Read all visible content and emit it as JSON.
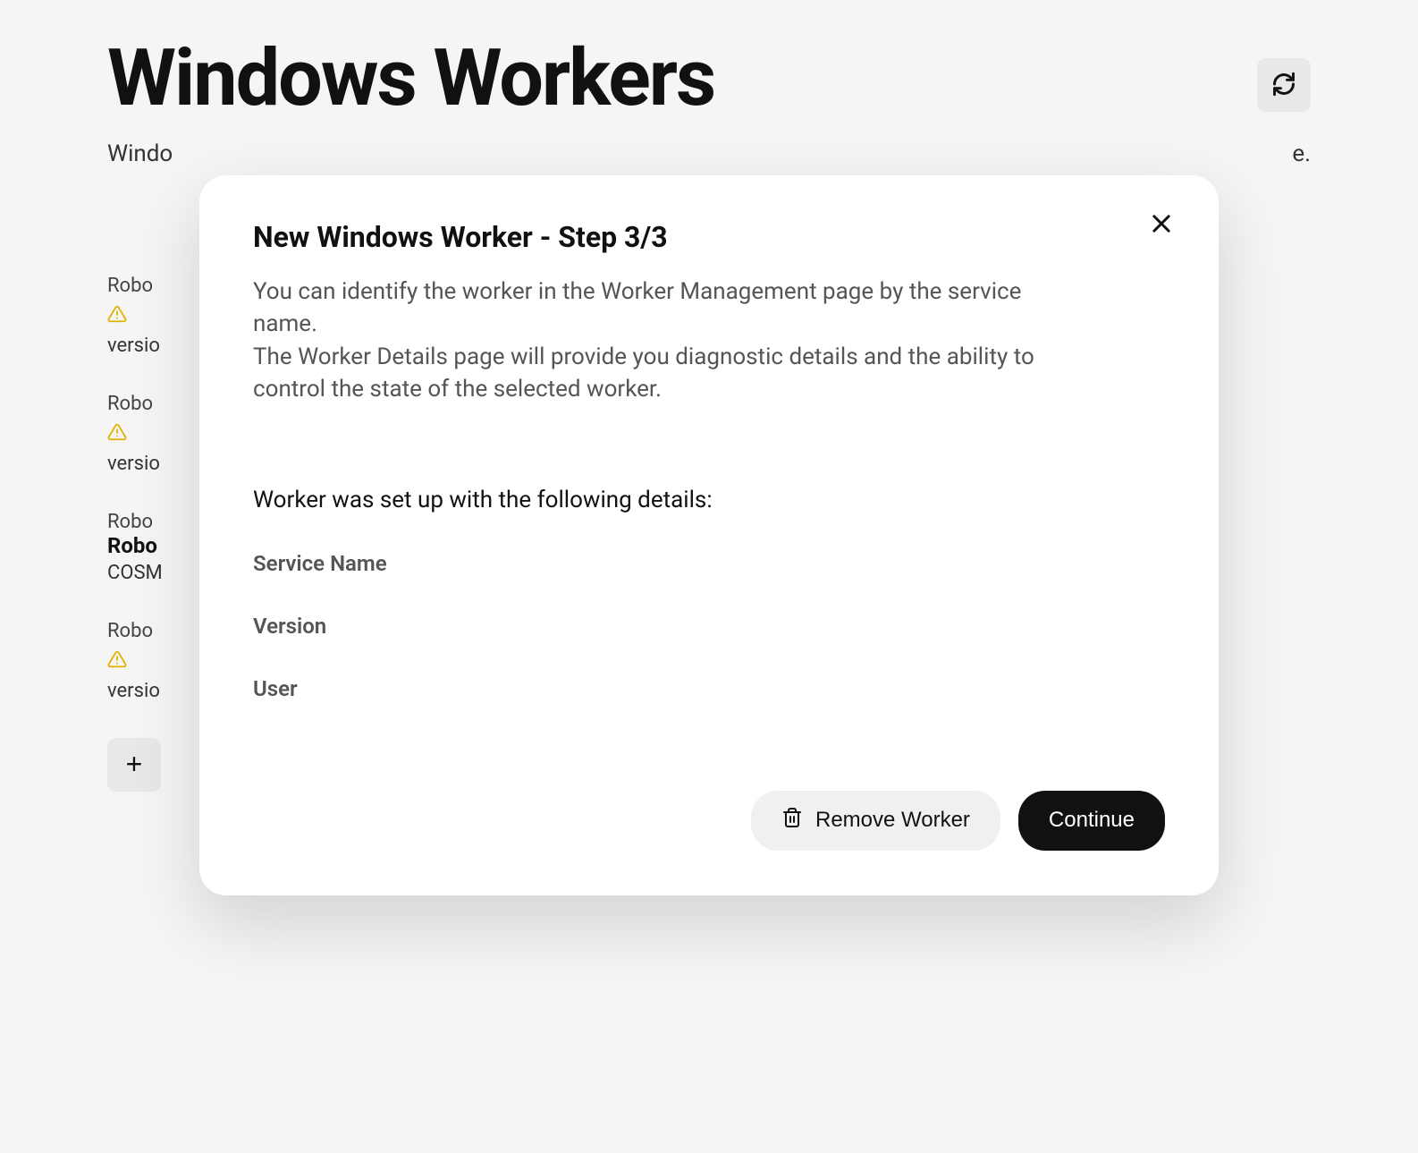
{
  "page": {
    "title": "Windows Workers",
    "subtitle_prefix": "Windo",
    "subtitle_suffix": "e."
  },
  "workers": [
    {
      "label": "Robo",
      "version_prefix": "versio"
    },
    {
      "label": "Robo",
      "version_prefix": "versio"
    },
    {
      "label": "Robo",
      "name_bold": "Robo",
      "sub": "COSM"
    },
    {
      "label": "Robo",
      "version_prefix": "versio"
    }
  ],
  "modal": {
    "title": "New Windows Worker - Step 3/3",
    "description_line1": "You can identify the worker in the Worker Management page by the service name.",
    "description_line2": "The Worker Details page will provide you diagnostic details and the ability to control the state of the selected worker.",
    "section_title": "Worker was set up with the following details:",
    "fields": {
      "service_name": "Service Name",
      "version": "Version",
      "user": "User"
    },
    "buttons": {
      "remove": "Remove Worker",
      "continue": "Continue"
    }
  }
}
